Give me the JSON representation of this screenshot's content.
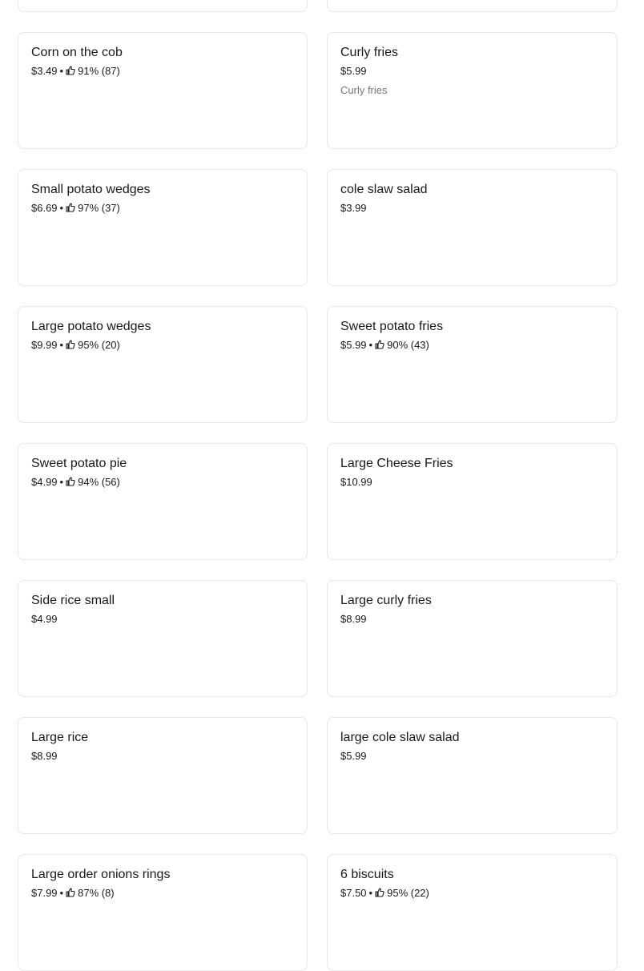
{
  "menu": {
    "items": [
      {
        "name": "",
        "price": "",
        "rating": "",
        "description": ""
      },
      {
        "name": "",
        "price": "",
        "rating": "",
        "description": ""
      },
      {
        "name": "Corn on the cob",
        "price": "$3.49",
        "rating": "91% (87)",
        "description": ""
      },
      {
        "name": "Curly fries",
        "price": "$5.99",
        "rating": "",
        "description": "Curly fries"
      },
      {
        "name": "Small potato wedges",
        "price": "$6.69",
        "rating": "97% (37)",
        "description": ""
      },
      {
        "name": "cole slaw salad",
        "price": "$3.99",
        "rating": "",
        "description": ""
      },
      {
        "name": "Large potato wedges",
        "price": "$9.99",
        "rating": "95% (20)",
        "description": ""
      },
      {
        "name": "Sweet potato fries",
        "price": "$5.99",
        "rating": "90% (43)",
        "description": ""
      },
      {
        "name": "Sweet potato pie",
        "price": "$4.99",
        "rating": "94% (56)",
        "description": ""
      },
      {
        "name": "Large Cheese Fries",
        "price": "$10.99",
        "rating": "",
        "description": ""
      },
      {
        "name": "Side rice small",
        "price": "$4.99",
        "rating": "",
        "description": ""
      },
      {
        "name": "Large curly fries",
        "price": "$8.99",
        "rating": "",
        "description": ""
      },
      {
        "name": "Large rice",
        "price": "$8.99",
        "rating": "",
        "description": ""
      },
      {
        "name": "large cole slaw salad",
        "price": "$5.99",
        "rating": "",
        "description": ""
      },
      {
        "name": "Large order onions rings",
        "price": "$7.99",
        "rating": "87% (8)",
        "description": ""
      },
      {
        "name": "6 biscuits",
        "price": "$7.50",
        "rating": "95% (22)",
        "description": ""
      }
    ],
    "separator": "•",
    "rating_icon": "thumbs-up-icon"
  }
}
